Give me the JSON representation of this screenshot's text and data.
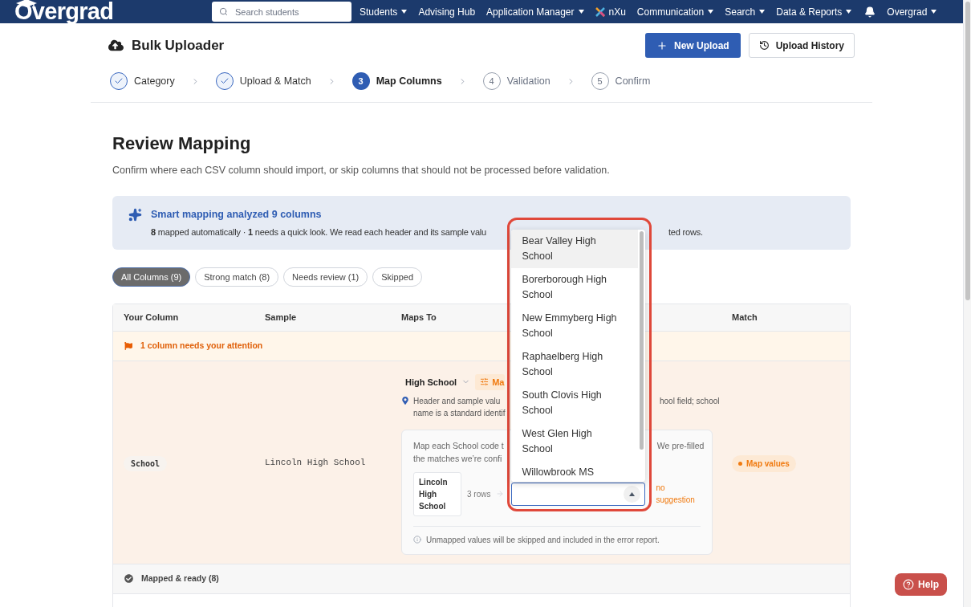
{
  "navbar": {
    "logo": "Overgrad",
    "search": {
      "placeholder": "Search students"
    },
    "items": [
      {
        "label": "Students",
        "has_menu": true,
        "kind": "link"
      },
      {
        "label": "Advising Hub",
        "has_menu": false,
        "kind": "link"
      },
      {
        "label": "Application Manager",
        "has_menu": true,
        "kind": "link"
      },
      {
        "label": "nXu",
        "has_menu": false,
        "kind": "brand"
      },
      {
        "label": "Communication",
        "has_menu": true,
        "kind": "link"
      },
      {
        "label": "Search",
        "has_menu": true,
        "kind": "link"
      },
      {
        "label": "Data & Reports",
        "has_menu": true,
        "kind": "link"
      }
    ],
    "account": {
      "label": "Overgrad",
      "has_menu": true
    }
  },
  "page": {
    "title": "Bulk Uploader",
    "actions": [
      {
        "label": "New Upload",
        "kind": "primary"
      },
      {
        "label": "Upload History",
        "kind": "secondary"
      }
    ]
  },
  "steps": [
    {
      "label": "Category",
      "kind": "done"
    },
    {
      "label": "Upload & Match",
      "kind": "done"
    },
    {
      "number": "3",
      "label": "Map Columns",
      "kind": "current"
    },
    {
      "number": "4",
      "label": "Validation",
      "kind": "upcoming"
    },
    {
      "number": "5",
      "label": "Confirm",
      "kind": "upcoming"
    }
  ],
  "review": {
    "title": "Review Mapping",
    "subtitle": "Confirm where each CSV column should import, or skip columns that should not be processed before validation."
  },
  "banner": {
    "title": "Smart mapping analyzed 9 columns",
    "text_left": "**8** mapped automatically · **1** needs a quick look. We read each header and its sample valu",
    "text_right": "ted rows."
  },
  "filters": [
    {
      "label": "All Columns (9)",
      "selected": true
    },
    {
      "label": "Strong match (8)",
      "selected": false
    },
    {
      "label": "Needs review (1)",
      "selected": false
    },
    {
      "label": "Skipped",
      "selected": false
    }
  ],
  "table": {
    "columns": [
      "Your Column",
      "Sample",
      "Maps To",
      "Match"
    ],
    "attention": "1 column needs your attention",
    "row": {
      "column": "School",
      "sample": "Lincoln High School",
      "maps_to": "High School",
      "map_button": "Ma",
      "hint_left": [
        "Header and sample valu",
        "name is a standard identif"
      ],
      "hint_right": "hool field; school",
      "card": {
        "text_left": [
          "Map each School code t",
          "the matches we’re confi"
        ],
        "text_right": "We pre-filled",
        "value": "Lincoln High School",
        "rows": "3 rows",
        "combobox": {
          "expanded": true,
          "options": [
            {
              "label": "Bear Valley High School",
              "selected": true
            },
            {
              "label": "Borerborough High School",
              "selected": false
            },
            {
              "label": "New Emmyberg High School",
              "selected": false
            },
            {
              "label": "Raphaelberg High School",
              "selected": false
            },
            {
              "label": "South Clovis High School",
              "selected": false
            },
            {
              "label": "West Glen High School",
              "selected": false
            },
            {
              "label": "Willowbrook MS",
              "selected": false
            }
          ]
        },
        "status": "no suggestion",
        "note": "Unmapped values will be skipped and included in the error report."
      },
      "match": "Map values"
    },
    "mapped_group": "Mapped & ready (8)"
  },
  "help": "Help"
}
